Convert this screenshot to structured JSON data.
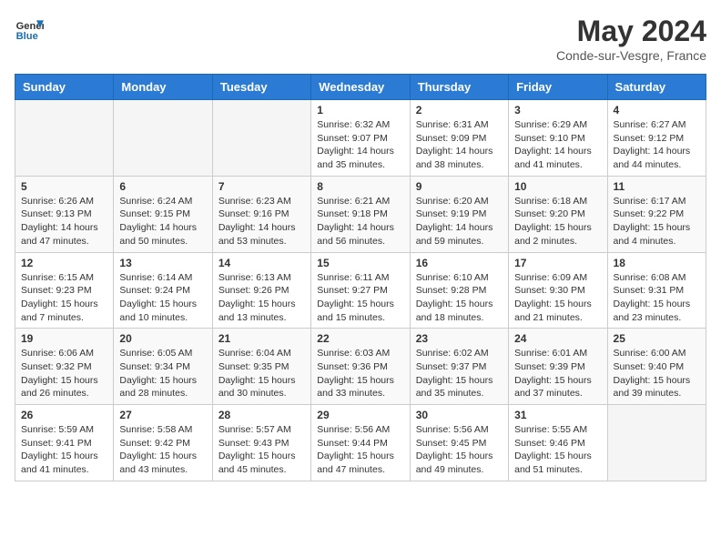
{
  "header": {
    "logo_line1": "General",
    "logo_line2": "Blue",
    "month": "May 2024",
    "location": "Conde-sur-Vesgre, France"
  },
  "days_of_week": [
    "Sunday",
    "Monday",
    "Tuesday",
    "Wednesday",
    "Thursday",
    "Friday",
    "Saturday"
  ],
  "weeks": [
    [
      {
        "day": "",
        "info": ""
      },
      {
        "day": "",
        "info": ""
      },
      {
        "day": "",
        "info": ""
      },
      {
        "day": "1",
        "info": "Sunrise: 6:32 AM\nSunset: 9:07 PM\nDaylight: 14 hours\nand 35 minutes."
      },
      {
        "day": "2",
        "info": "Sunrise: 6:31 AM\nSunset: 9:09 PM\nDaylight: 14 hours\nand 38 minutes."
      },
      {
        "day": "3",
        "info": "Sunrise: 6:29 AM\nSunset: 9:10 PM\nDaylight: 14 hours\nand 41 minutes."
      },
      {
        "day": "4",
        "info": "Sunrise: 6:27 AM\nSunset: 9:12 PM\nDaylight: 14 hours\nand 44 minutes."
      }
    ],
    [
      {
        "day": "5",
        "info": "Sunrise: 6:26 AM\nSunset: 9:13 PM\nDaylight: 14 hours\nand 47 minutes."
      },
      {
        "day": "6",
        "info": "Sunrise: 6:24 AM\nSunset: 9:15 PM\nDaylight: 14 hours\nand 50 minutes."
      },
      {
        "day": "7",
        "info": "Sunrise: 6:23 AM\nSunset: 9:16 PM\nDaylight: 14 hours\nand 53 minutes."
      },
      {
        "day": "8",
        "info": "Sunrise: 6:21 AM\nSunset: 9:18 PM\nDaylight: 14 hours\nand 56 minutes."
      },
      {
        "day": "9",
        "info": "Sunrise: 6:20 AM\nSunset: 9:19 PM\nDaylight: 14 hours\nand 59 minutes."
      },
      {
        "day": "10",
        "info": "Sunrise: 6:18 AM\nSunset: 9:20 PM\nDaylight: 15 hours\nand 2 minutes."
      },
      {
        "day": "11",
        "info": "Sunrise: 6:17 AM\nSunset: 9:22 PM\nDaylight: 15 hours\nand 4 minutes."
      }
    ],
    [
      {
        "day": "12",
        "info": "Sunrise: 6:15 AM\nSunset: 9:23 PM\nDaylight: 15 hours\nand 7 minutes."
      },
      {
        "day": "13",
        "info": "Sunrise: 6:14 AM\nSunset: 9:24 PM\nDaylight: 15 hours\nand 10 minutes."
      },
      {
        "day": "14",
        "info": "Sunrise: 6:13 AM\nSunset: 9:26 PM\nDaylight: 15 hours\nand 13 minutes."
      },
      {
        "day": "15",
        "info": "Sunrise: 6:11 AM\nSunset: 9:27 PM\nDaylight: 15 hours\nand 15 minutes."
      },
      {
        "day": "16",
        "info": "Sunrise: 6:10 AM\nSunset: 9:28 PM\nDaylight: 15 hours\nand 18 minutes."
      },
      {
        "day": "17",
        "info": "Sunrise: 6:09 AM\nSunset: 9:30 PM\nDaylight: 15 hours\nand 21 minutes."
      },
      {
        "day": "18",
        "info": "Sunrise: 6:08 AM\nSunset: 9:31 PM\nDaylight: 15 hours\nand 23 minutes."
      }
    ],
    [
      {
        "day": "19",
        "info": "Sunrise: 6:06 AM\nSunset: 9:32 PM\nDaylight: 15 hours\nand 26 minutes."
      },
      {
        "day": "20",
        "info": "Sunrise: 6:05 AM\nSunset: 9:34 PM\nDaylight: 15 hours\nand 28 minutes."
      },
      {
        "day": "21",
        "info": "Sunrise: 6:04 AM\nSunset: 9:35 PM\nDaylight: 15 hours\nand 30 minutes."
      },
      {
        "day": "22",
        "info": "Sunrise: 6:03 AM\nSunset: 9:36 PM\nDaylight: 15 hours\nand 33 minutes."
      },
      {
        "day": "23",
        "info": "Sunrise: 6:02 AM\nSunset: 9:37 PM\nDaylight: 15 hours\nand 35 minutes."
      },
      {
        "day": "24",
        "info": "Sunrise: 6:01 AM\nSunset: 9:39 PM\nDaylight: 15 hours\nand 37 minutes."
      },
      {
        "day": "25",
        "info": "Sunrise: 6:00 AM\nSunset: 9:40 PM\nDaylight: 15 hours\nand 39 minutes."
      }
    ],
    [
      {
        "day": "26",
        "info": "Sunrise: 5:59 AM\nSunset: 9:41 PM\nDaylight: 15 hours\nand 41 minutes."
      },
      {
        "day": "27",
        "info": "Sunrise: 5:58 AM\nSunset: 9:42 PM\nDaylight: 15 hours\nand 43 minutes."
      },
      {
        "day": "28",
        "info": "Sunrise: 5:57 AM\nSunset: 9:43 PM\nDaylight: 15 hours\nand 45 minutes."
      },
      {
        "day": "29",
        "info": "Sunrise: 5:56 AM\nSunset: 9:44 PM\nDaylight: 15 hours\nand 47 minutes."
      },
      {
        "day": "30",
        "info": "Sunrise: 5:56 AM\nSunset: 9:45 PM\nDaylight: 15 hours\nand 49 minutes."
      },
      {
        "day": "31",
        "info": "Sunrise: 5:55 AM\nSunset: 9:46 PM\nDaylight: 15 hours\nand 51 minutes."
      },
      {
        "day": "",
        "info": ""
      }
    ]
  ]
}
